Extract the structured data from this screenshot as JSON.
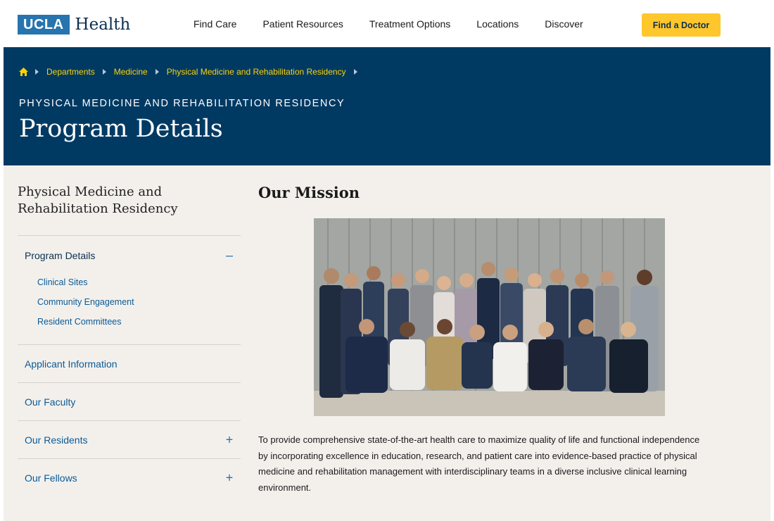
{
  "header": {
    "logo_box": "UCLA",
    "logo_word": "Health",
    "nav": [
      "Find Care",
      "Patient Resources",
      "Treatment Options",
      "Locations",
      "Discover"
    ],
    "cta": "Find a Doctor"
  },
  "hero": {
    "breadcrumb": [
      "Departments",
      "Medicine",
      "Physical Medicine and Rehabilitation Residency"
    ],
    "eyebrow": "PHYSICAL MEDICINE AND REHABILITATION RESIDENCY",
    "title": "Program Details"
  },
  "sidebar": {
    "title": "Physical Medicine and Rehabilitation Residency",
    "active": {
      "label": "Program Details",
      "toggle": "–"
    },
    "sub_items": [
      "Clinical Sites",
      "Community Engagement",
      "Resident Committees"
    ],
    "items": [
      {
        "label": "Applicant Information",
        "toggle": ""
      },
      {
        "label": "Our Faculty",
        "toggle": ""
      },
      {
        "label": "Our Residents",
        "toggle": "+"
      },
      {
        "label": "Our Fellows",
        "toggle": "+"
      }
    ]
  },
  "main": {
    "title": "Our Mission",
    "mission": "To provide comprehensive state-of-the-art health care to maximize quality of life and functional independence by incorporating excellence in education, research, and patient care into evidence-based practice of physical medicine and rehabilitation management with interdisciplinary teams in a diverse inclusive clinical learning environment."
  },
  "colors": {
    "brand_blue": "#2774ae",
    "hero_navy": "#003a63",
    "accent_gold": "#ffd100",
    "cta_gold": "#ffc72c",
    "page_bg": "#f3f0ec"
  },
  "icons": {
    "home": "home-icon",
    "breadcrumb_separator": "caret-right-icon",
    "collapse": "minus-icon",
    "expand": "plus-icon"
  }
}
